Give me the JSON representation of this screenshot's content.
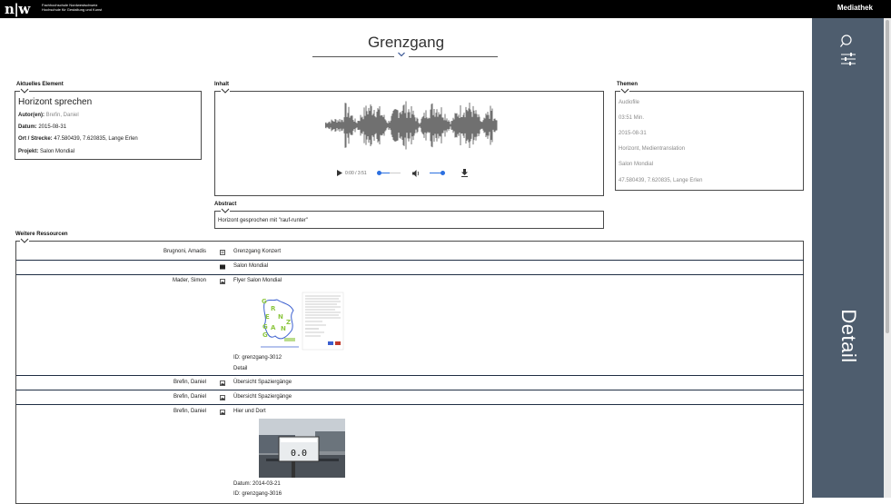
{
  "topbar": {
    "logo": "n|w",
    "institution_line1": "Fachhochschule Nordwestschweiz",
    "institution_line2": "Hochschule für Gestaltung und Kunst",
    "app_label": "Mediathek"
  },
  "page": {
    "title": "Grenzgang"
  },
  "side_panel": {
    "detail_label": "Detail",
    "icons": [
      "search-icon",
      "filter-icon"
    ]
  },
  "current_element": {
    "section_label": "Aktuelles Element",
    "title": "Horizont sprechen",
    "author_label": "Autor(en):",
    "author_value": "Brefin, Daniel",
    "date_label": "Datum:",
    "date_value": "2015-08-31",
    "location_label": "Ort / Strecke:",
    "location_value": "47.580439, 7.620835, Lange Erlen",
    "project_label": "Projekt:",
    "project_value": "Salon Mondial"
  },
  "content": {
    "section_label": "Inhalt",
    "player": {
      "time": "0:00 / 3:51",
      "progress": 0,
      "volume": 0.8
    }
  },
  "themes": {
    "section_label": "Themen",
    "items": [
      "Audiofile",
      "03:51 Min.",
      "2015-08-31",
      "Horizont, Medientranslation",
      "Salon Mondial",
      "47.580439, 7.620835, Lange Erlen"
    ]
  },
  "abstract": {
    "section_label": "Abstract",
    "text": "Horizont gesprochen mit \"rauf-runter\""
  },
  "resources": {
    "section_label": "Weitere Ressourcen",
    "rows": [
      {
        "author": "Brugnoni, Amadis",
        "icon": "document-icon",
        "title": "Grenzgang Konzert"
      },
      {
        "author": "",
        "icon": "folder-icon",
        "title": "Salon Mondial"
      },
      {
        "author": "Mader, Simon",
        "icon": "image-icon",
        "title": "Flyer Salon Mondial",
        "id": "ID: grenzgang-3012",
        "link": "Detail",
        "flyer_letters": [
          "G",
          "R",
          "E",
          "N",
          "Z",
          "G",
          "A",
          "N",
          "G"
        ]
      },
      {
        "author": "Brefin, Daniel",
        "icon": "image-icon",
        "title": "Übersicht Spaziergänge"
      },
      {
        "author": "Brefin, Daniel",
        "icon": "image-icon",
        "title": "Übersicht Spaziergänge"
      },
      {
        "author": "Brefin, Daniel",
        "icon": "image-icon",
        "title": "Hier und Dort",
        "date": "Datum: 2014-03-21",
        "id": "ID: grenzgang-3016",
        "photo_sign_text": "0.0"
      }
    ]
  },
  "colors": {
    "side_panel": "#4e5d6e",
    "topbar": "#000000",
    "row_line": "#1f2e44"
  }
}
